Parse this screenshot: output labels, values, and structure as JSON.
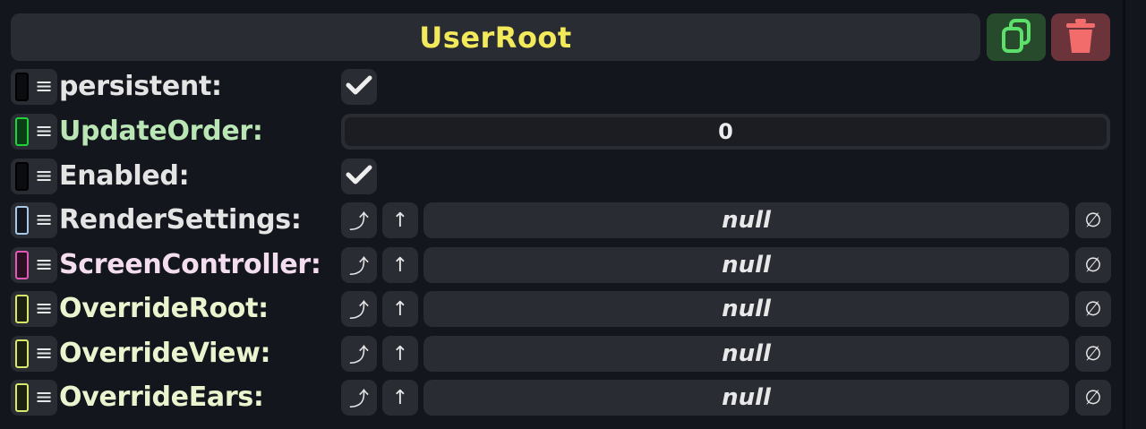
{
  "header": {
    "title": "UserRoot"
  },
  "icons": {
    "duplicate": "duplicate-icon",
    "delete": "trash-icon",
    "menu": "hamburger-icon",
    "jump": "jump-to-icon",
    "up": "up-arrow-icon",
    "clear": "null-icon",
    "check": "checkmark-icon"
  },
  "colors": {
    "title": "#f2ea5a",
    "duplicate": "#5de06a",
    "delete": "#f26c6c"
  },
  "fields": [
    {
      "label": "persistent:",
      "type": "checkbox",
      "checked": true,
      "label_color": "#e4e4e4",
      "slot_color": "#0b0c10",
      "slot_border": "#000000"
    },
    {
      "label": "UpdateOrder:",
      "type": "number",
      "value": "0",
      "label_color": "#b9e6b4",
      "slot_color": "#0b3d14",
      "slot_border": "#1fd13c"
    },
    {
      "label": "Enabled:",
      "type": "checkbox",
      "checked": true,
      "label_color": "#e4e4e4",
      "slot_color": "#0b0c10",
      "slot_border": "#000000"
    },
    {
      "label": "RenderSettings:",
      "type": "reference",
      "value": "null",
      "label_color": "#e4e4e4",
      "slot_color": "#13161f",
      "slot_border": "#a8c8e8"
    },
    {
      "label": "ScreenController:",
      "type": "reference",
      "value": "null",
      "label_color": "#f3ddee",
      "slot_color": "#2a1022",
      "slot_border": "#e05ab5"
    },
    {
      "label": "OverrideRoot:",
      "type": "reference",
      "value": "null",
      "label_color": "#eaf5d0",
      "slot_color": "#1c2010",
      "slot_border": "#d8e86a"
    },
    {
      "label": "OverrideView:",
      "type": "reference",
      "value": "null",
      "label_color": "#eaf5d0",
      "slot_color": "#1c2010",
      "slot_border": "#d8e86a"
    },
    {
      "label": "OverrideEars:",
      "type": "reference",
      "value": "null",
      "label_color": "#eaf5d0",
      "slot_color": "#1c2010",
      "slot_border": "#d8e86a"
    }
  ]
}
